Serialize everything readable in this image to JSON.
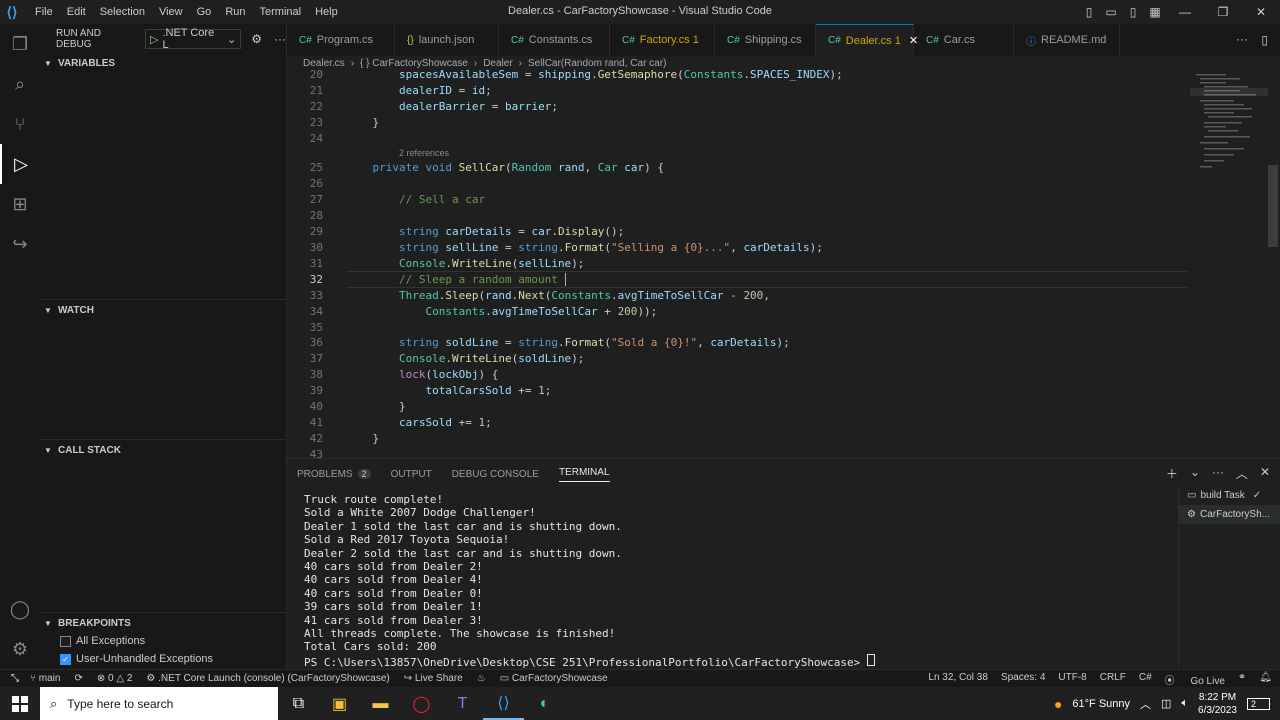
{
  "title_bar": {
    "window_title": "Dealer.cs - CarFactoryShowcase - Visual Studio Code",
    "menu": [
      "File",
      "Edit",
      "Selection",
      "View",
      "Go",
      "Run",
      "Terminal",
      "Help"
    ]
  },
  "sidebar": {
    "header": "RUN AND DEBUG",
    "launch_config": ".NET Core L",
    "sections": {
      "variables": "VARIABLES",
      "watch": "WATCH",
      "call_stack": "CALL STACK",
      "breakpoints": "BREAKPOINTS"
    },
    "breakpoints": [
      {
        "label": "All Exceptions",
        "checked": false
      },
      {
        "label": "User-Unhandled Exceptions",
        "checked": true
      }
    ]
  },
  "tabs": [
    {
      "label": "Program.cs",
      "icon": "csharp-icon"
    },
    {
      "label": "launch.json",
      "icon": "json-icon"
    },
    {
      "label": "Constants.cs",
      "icon": "csharp-icon"
    },
    {
      "label": "Factory.cs 1",
      "icon": "csharp-icon"
    },
    {
      "label": "Shipping.cs",
      "icon": "csharp-icon"
    },
    {
      "label": "Dealer.cs 1",
      "icon": "csharp-icon"
    },
    {
      "label": "Car.cs",
      "icon": "csharp-icon"
    },
    {
      "label": "README.md",
      "icon": "info-icon"
    }
  ],
  "breadcrumb": [
    "Dealer.cs",
    "{ } CarFactoryShowcase",
    "Dealer",
    "SellCar(Random rand, Car car)"
  ],
  "editor": {
    "codelens": "2 references",
    "line_numbers": [
      "20",
      "21",
      "22",
      "23",
      "24",
      "25",
      "26",
      "27",
      "28",
      "29",
      "30",
      "31",
      "32",
      "33",
      "34",
      "35",
      "36",
      "37",
      "38",
      "39",
      "40",
      "41",
      "42",
      "43"
    ],
    "cursor_line": "32"
  },
  "panel": {
    "tabs": [
      {
        "label": "PROBLEMS",
        "badge": "2"
      },
      {
        "label": "OUTPUT"
      },
      {
        "label": "DEBUG CONSOLE"
      },
      {
        "label": "TERMINAL"
      }
    ],
    "terminal_lines": [
      "Truck route complete!",
      "Sold a White 2007 Dodge Challenger!",
      "Dealer 1 sold the last car and is shutting down.",
      "Sold a Red 2017 Toyota Sequoia!",
      "Dealer 2 sold the last car and is shutting down.",
      "40 cars sold from Dealer 2!",
      "40 cars sold from Dealer 4!",
      "40 cars sold from Dealer 0!",
      "39 cars sold from Dealer 1!",
      "41 cars sold from Dealer 3!",
      "All threads complete. The showcase is finished!",
      "Total Cars sold: 200",
      "PS C:\\Users\\13857\\OneDrive\\Desktop\\CSE 251\\ProfessionalPortfolio\\CarFactoryShowcase> "
    ],
    "terminal_list": [
      "build Task",
      "CarFactorySh..."
    ]
  },
  "status_bar": {
    "branch": "main",
    "errors": "0",
    "warnings": "2",
    "launch": ".NET Core Launch (console) (CarFactoryShowcase)",
    "live_share": "Live Share",
    "project": "CarFactoryShowcase",
    "position": "Ln 32, Col 38",
    "spaces": "Spaces: 4",
    "encoding": "UTF-8",
    "eol": "CRLF",
    "language": "C#",
    "go_live": "Go Live"
  },
  "taskbar": {
    "search_placeholder": "Type here to search",
    "weather": "61°F  Sunny",
    "time": "8:22 PM",
    "date": "6/3/2023",
    "notifications": "2"
  },
  "colors": {
    "accent": "#0078d4",
    "keyword": "#569cd6",
    "type": "#4ec9b0",
    "string": "#ce9178",
    "comment": "#6a9955"
  }
}
